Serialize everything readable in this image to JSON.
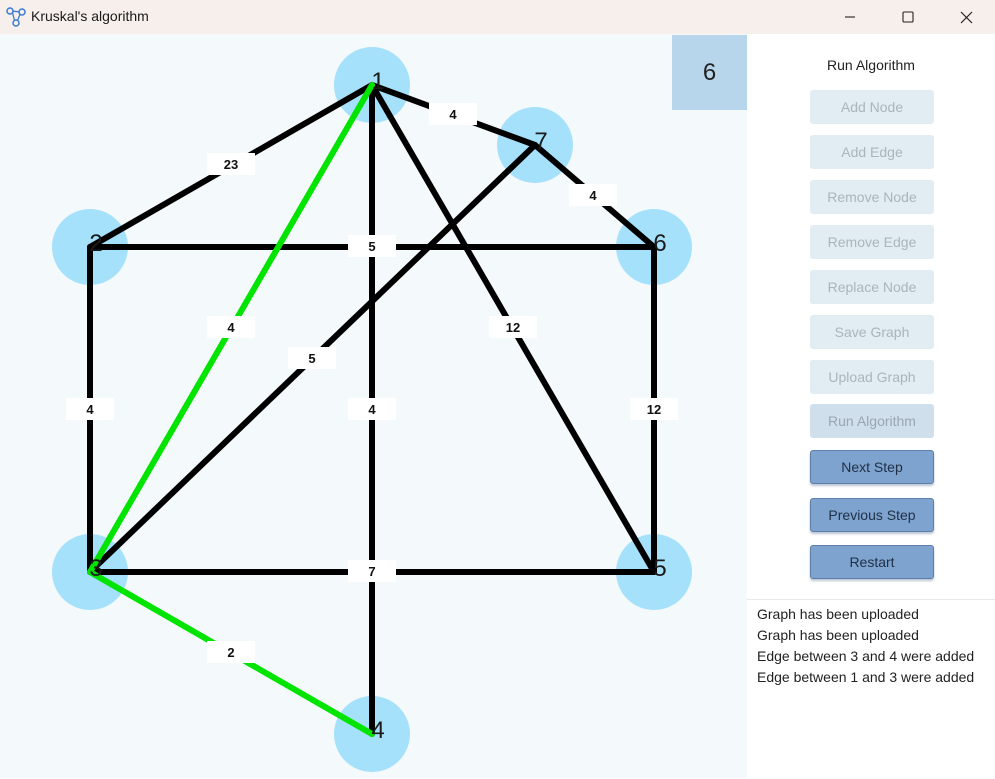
{
  "window": {
    "title": "Kruskal's algorithm",
    "app_icon": "graph-nodes-icon",
    "controls": [
      "minimize-icon",
      "maximize-icon",
      "close-icon"
    ]
  },
  "counter": "6",
  "panel": {
    "title": "Run Algorithm",
    "buttons": {
      "add_node": "Add Node",
      "add_edge": "Add Edge",
      "remove_node": "Remove Node",
      "remove_edge": "Remove Edge",
      "replace_node": "Replace Node",
      "save_graph": "Save Graph",
      "upload_graph": "Upload Graph",
      "run_algorithm": "Run Algorithm",
      "next_step": "Next Step",
      "previous_step": "Previous Step",
      "restart": "Restart"
    }
  },
  "log": [
    "Graph has been uploaded",
    "Graph has been uploaded",
    "Edge between 3 and 4 were added",
    "Edge between 1 and 3 were added"
  ],
  "colors": {
    "node": "#a6e1fb",
    "edge": "#000000",
    "mst_edge": "#00e400",
    "canvas": "#f4f9fc"
  },
  "graph": {
    "nodes": [
      {
        "id": "1",
        "label": "1"
      },
      {
        "id": "2",
        "label": "2"
      },
      {
        "id": "3",
        "label": "3"
      },
      {
        "id": "4",
        "label": "4"
      },
      {
        "id": "5",
        "label": "5"
      },
      {
        "id": "6",
        "label": "6"
      },
      {
        "id": "7",
        "label": "7"
      }
    ],
    "edges": [
      {
        "from": "1",
        "to": "2",
        "weight": "23",
        "in_mst": false
      },
      {
        "from": "1",
        "to": "7",
        "weight": "4",
        "in_mst": false
      },
      {
        "from": "7",
        "to": "6",
        "weight": "4",
        "in_mst": false
      },
      {
        "from": "2",
        "to": "6",
        "weight": "5",
        "in_mst": false
      },
      {
        "from": "1",
        "to": "3",
        "weight": "4",
        "in_mst": true
      },
      {
        "from": "7",
        "to": "3",
        "weight": "5",
        "in_mst": false
      },
      {
        "from": "1",
        "to": "5",
        "weight": "12",
        "in_mst": false
      },
      {
        "from": "2",
        "to": "3",
        "weight": "4",
        "in_mst": false
      },
      {
        "from": "1",
        "to": "4",
        "weight": "4",
        "in_mst": false
      },
      {
        "from": "6",
        "to": "5",
        "weight": "12",
        "in_mst": false
      },
      {
        "from": "3",
        "to": "5",
        "weight": "7",
        "in_mst": false
      },
      {
        "from": "3",
        "to": "4",
        "weight": "2",
        "in_mst": true
      }
    ]
  }
}
